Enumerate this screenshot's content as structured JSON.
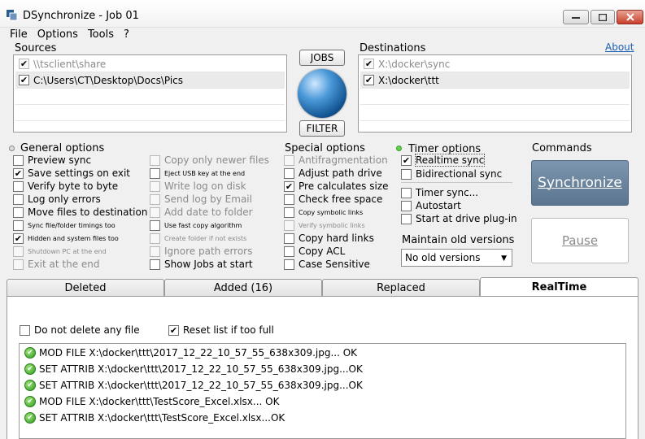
{
  "window": {
    "title": "DSynchronize - Job 01",
    "controls": {
      "minimize": "▭",
      "maximize": "□",
      "close": "✕"
    }
  },
  "menu": [
    "File",
    "Options",
    "Tools",
    "?"
  ],
  "sources": {
    "label": "Sources",
    "items": [
      {
        "path": "\\\\tsclient\\share",
        "checked": true,
        "dimmed": true
      },
      {
        "path": "C:\\Users\\CT\\Desktop\\Docs\\Pics",
        "checked": true,
        "dimmed": false
      }
    ]
  },
  "destinations": {
    "label": "Destinations",
    "items": [
      {
        "path": "X:\\docker\\sync",
        "checked": true,
        "dimmed": true
      },
      {
        "path": "X:\\docker\\ttt",
        "checked": true,
        "dimmed": false
      }
    ]
  },
  "about_link": "About",
  "buttons": {
    "jobs": "JOBS",
    "filter": "FILTER"
  },
  "general_options": {
    "title": "General options",
    "left": [
      {
        "label": "Preview sync",
        "checked": false,
        "enabled": true,
        "small": false
      },
      {
        "label": "Save settings on exit",
        "checked": true,
        "enabled": true,
        "small": false
      },
      {
        "label": "Verify byte to byte",
        "checked": false,
        "enabled": true,
        "small": false
      },
      {
        "label": "Log only errors",
        "checked": false,
        "enabled": true,
        "small": false
      },
      {
        "label": "Move files to destination",
        "checked": false,
        "enabled": true,
        "small": false
      },
      {
        "label": "Sync file/folder timings too",
        "checked": false,
        "enabled": true,
        "small": true
      },
      {
        "label": "Hidden and system files too",
        "checked": true,
        "enabled": true,
        "small": true
      },
      {
        "label": "Shutdown PC at the end",
        "checked": false,
        "enabled": false,
        "small": true
      },
      {
        "label": "Exit at the end",
        "checked": false,
        "enabled": false,
        "small": false
      }
    ],
    "right": [
      {
        "label": "Copy only newer files",
        "checked": false,
        "enabled": false,
        "small": false
      },
      {
        "label": "Eject USB key at the end",
        "checked": false,
        "enabled": true,
        "small": true
      },
      {
        "label": "Write log on disk",
        "checked": false,
        "enabled": false,
        "small": false
      },
      {
        "label": "Send log by Email",
        "checked": false,
        "enabled": false,
        "small": false
      },
      {
        "label": "Add date to folder",
        "checked": false,
        "enabled": false,
        "small": false
      },
      {
        "label": "Use fast copy algorithm",
        "checked": false,
        "enabled": true,
        "small": true
      },
      {
        "label": "Create folder if not exists",
        "checked": false,
        "enabled": false,
        "small": true
      },
      {
        "label": "Ignore path errors",
        "checked": false,
        "enabled": false,
        "small": false
      },
      {
        "label": "Show Jobs at start",
        "checked": false,
        "enabled": true,
        "small": false
      }
    ]
  },
  "special_options": {
    "title": "Special options",
    "items": [
      {
        "label": "Antifragmentation",
        "checked": false,
        "enabled": false,
        "small": false
      },
      {
        "label": "Adjust path drive",
        "checked": false,
        "enabled": true,
        "small": false
      },
      {
        "label": "Pre calculates size",
        "checked": true,
        "enabled": true,
        "small": false
      },
      {
        "label": "Check free space",
        "checked": false,
        "enabled": true,
        "small": false
      },
      {
        "label": "Copy symbolic links",
        "checked": false,
        "enabled": true,
        "small": true
      },
      {
        "label": "Verify symbolic links",
        "checked": false,
        "enabled": false,
        "small": true
      },
      {
        "label": "Copy hard links",
        "checked": false,
        "enabled": true,
        "small": false
      },
      {
        "label": "Copy ACL",
        "checked": false,
        "enabled": true,
        "small": false
      },
      {
        "label": "Case Sensitive",
        "checked": false,
        "enabled": true,
        "small": false
      }
    ]
  },
  "timer_options": {
    "title": "Timer options",
    "items": [
      {
        "label": "Realtime sync",
        "checked": true
      },
      {
        "label": "Bidirectional sync",
        "checked": false
      },
      {
        "label": "Timer sync...",
        "checked": false
      },
      {
        "label": "Autostart",
        "checked": false
      },
      {
        "label": "Start at drive plug-in",
        "checked": false
      }
    ]
  },
  "old_versions": {
    "title": "Maintain old versions",
    "selected": "No old versions"
  },
  "commands": {
    "title": "Commands",
    "synchronize": "Synchronize",
    "pause": "Pause"
  },
  "tabs": [
    "Deleted",
    "Added (16)",
    "Replaced",
    "RealTime"
  ],
  "active_tab": "RealTime",
  "realtime": {
    "do_not_delete": {
      "label": "Do not delete any file",
      "checked": false
    },
    "reset_list": {
      "label": "Reset list if too full",
      "checked": true
    },
    "log": [
      "MOD FILE X:\\docker\\ttt\\2017_12_22_10_57_55_638x309.jpg... OK",
      "SET ATTRIB X:\\docker\\ttt\\2017_12_22_10_57_55_638x309.jpg...OK",
      "SET ATTRIB X:\\docker\\ttt\\2017_12_22_10_57_55_638x309.jpg...OK",
      "MOD FILE X:\\docker\\ttt\\TestScore_Excel.xlsx... OK",
      "SET ATTRIB X:\\docker\\ttt\\TestScore_Excel.xlsx...OK"
    ]
  },
  "colors": {
    "accent": "#5b7590",
    "link": "#1a5fb4",
    "ok_green": "#2e9a1d"
  }
}
